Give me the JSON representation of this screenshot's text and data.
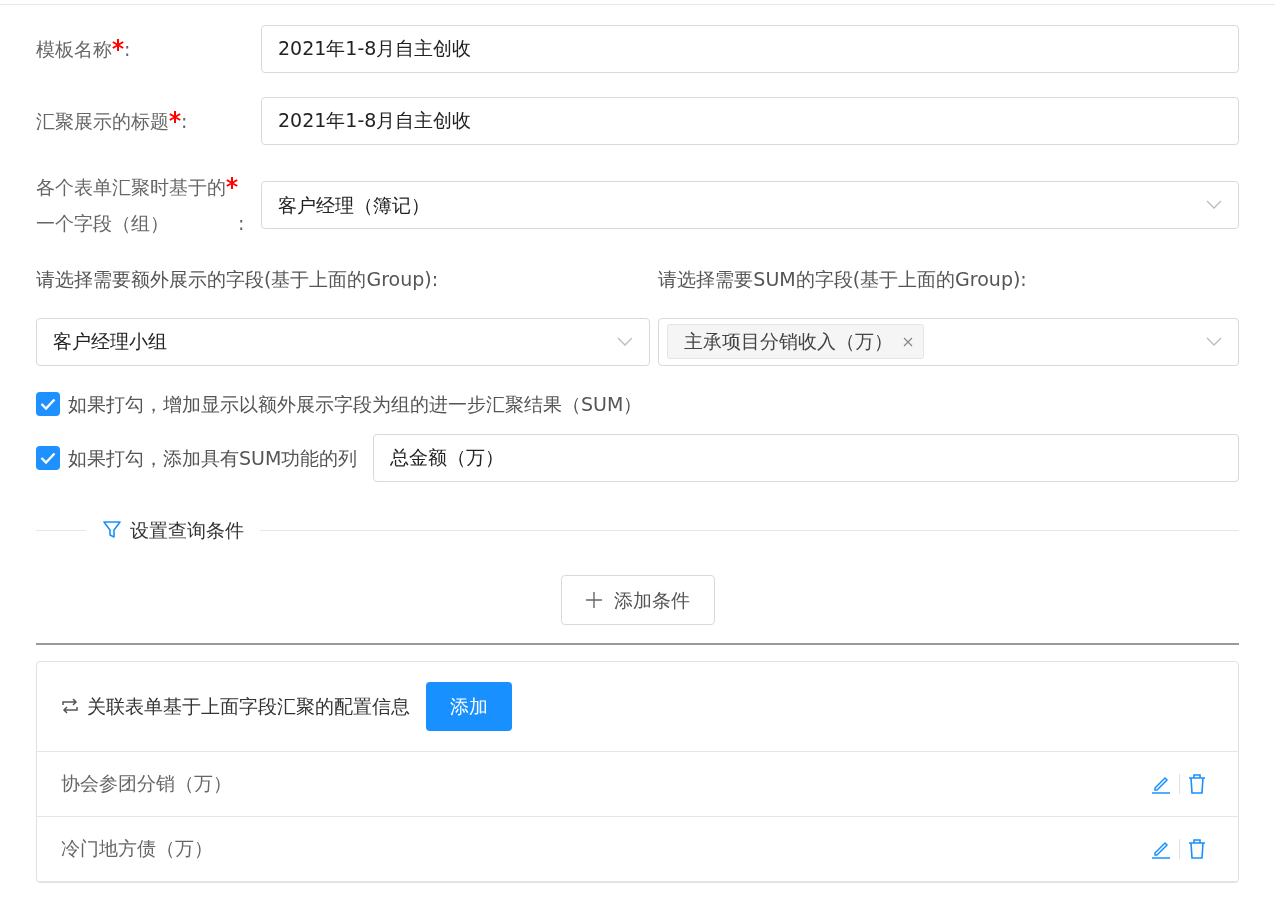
{
  "form_fields": [
    {
      "label": "模板名称",
      "suffix": ":",
      "required": true,
      "kind": "input",
      "value": "2021年1-8月自主创收"
    },
    {
      "label": "汇聚展示的标题",
      "suffix": ":",
      "required": true,
      "kind": "input",
      "value": "2021年1-8月自主创收"
    },
    {
      "label": "各个表单汇聚时基于的一个字段（组）",
      "suffix": ":",
      "required": true,
      "kind": "select",
      "value": "客户经理（簿记）"
    }
  ],
  "extra_field": {
    "label": "请选择需要额外展示的字段(基于上面的Group):",
    "value": "客户经理小组"
  },
  "sum_field": {
    "label": "请选择需要SUM的字段(基于上面的Group):",
    "tags": [
      {
        "text": "主承项目分销收入（万）"
      }
    ]
  },
  "options": [
    {
      "label": "如果打勾，增加显示以额外展示字段为组的进一步汇聚结果（SUM）",
      "checked": true
    },
    {
      "label": "如果打勾，添加具有SUM功能的列",
      "checked": true,
      "value": "总金额（万）"
    }
  ],
  "query_divider": {
    "title": "设置查询条件"
  },
  "add_condition_button": {
    "label": "添加条件"
  },
  "config_card": {
    "title": "关联表单基于上面字段汇聚的配置信息",
    "add_button": "添加",
    "rows": [
      {
        "name": "协会参团分销（万）"
      },
      {
        "name": "冷门地方债（万）"
      }
    ]
  }
}
